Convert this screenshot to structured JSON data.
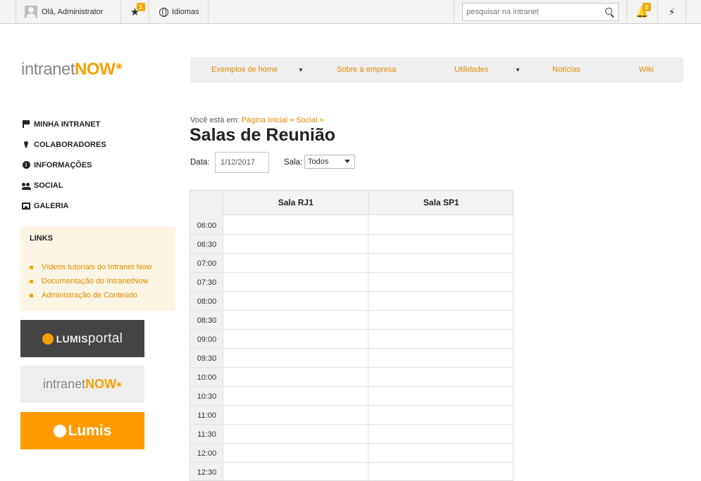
{
  "topbar": {
    "greeting": "Olá, Administrator",
    "favorites_badge": "1",
    "language_label": "Idiomas",
    "search_placeholder": "pesquisar na intranet",
    "notifications_badge": "2"
  },
  "logo": {
    "text_light": "intranet",
    "text_bold": "NOW"
  },
  "nav": {
    "items": [
      {
        "label": "Exemplos de home",
        "has_dropdown": true
      },
      {
        "label": "Sobre a empresa",
        "has_dropdown": false
      },
      {
        "label": "Utilidades",
        "has_dropdown": true
      },
      {
        "label": "Notícias",
        "has_dropdown": false
      },
      {
        "label": "Wiki",
        "has_dropdown": false
      }
    ]
  },
  "sidebar": {
    "items": [
      {
        "label": "MINHA INTRANET",
        "icon": "flag-icon"
      },
      {
        "label": "COLABORADORES",
        "icon": "tie-icon"
      },
      {
        "label": "INFORMAÇÕES",
        "icon": "info-icon"
      },
      {
        "label": "SOCIAL",
        "icon": "people-icon"
      },
      {
        "label": "GALERIA",
        "icon": "gallery-icon"
      }
    ],
    "links": {
      "title": "LINKS",
      "items": [
        "Vídeos tutoriais do Intranet Now",
        "Documentação do IntranetNow",
        "Administração de Conteúdo"
      ]
    },
    "banners": {
      "lumisportal": {
        "bold": "LUMIS",
        "light": "portal"
      },
      "intranetnow": {
        "light": "intranet",
        "bold": "NOW"
      },
      "lumis": {
        "text": "Lumis"
      }
    }
  },
  "main": {
    "breadcrumb_prefix": "Você está em:",
    "breadcrumb": [
      "Página Inicial",
      "Social"
    ],
    "title": "Salas de Reunião",
    "filters": {
      "date_label": "Data:",
      "date_value": "1/12/2017",
      "room_label": "Sala:",
      "room_value": "Todos"
    },
    "calendar": {
      "rooms": [
        "Sala RJ1",
        "Sala SP1"
      ],
      "times": [
        "06:00",
        "06:30",
        "07:00",
        "07:30",
        "08:00",
        "08:30",
        "09:00",
        "09:30",
        "10:00",
        "10:30",
        "11:00",
        "11:30",
        "12:00",
        "12:30"
      ]
    }
  },
  "colors": {
    "accent": "#f5a000",
    "link": "#e08a00",
    "links_bg": "#fdf5e4"
  }
}
